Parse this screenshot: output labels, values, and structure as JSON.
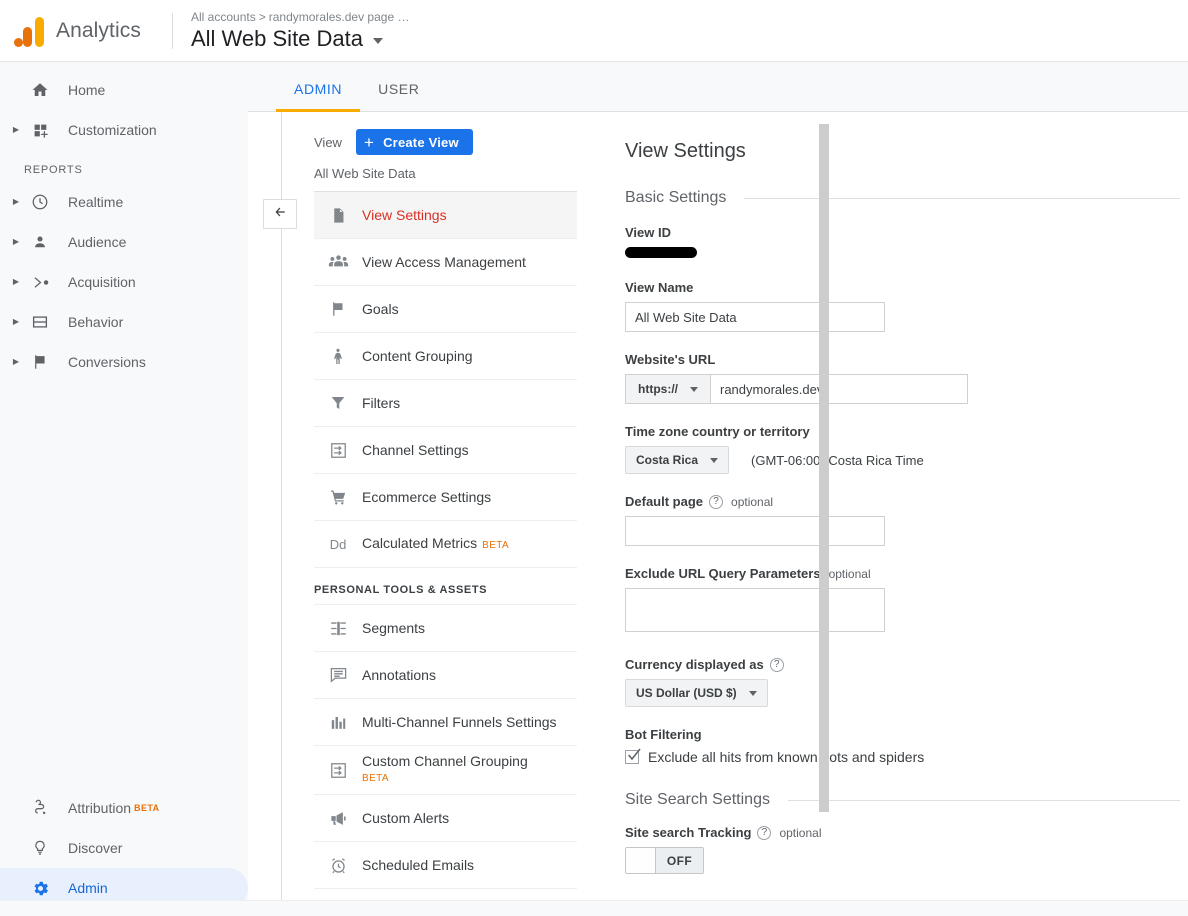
{
  "header": {
    "product": "Analytics",
    "breadcrumb": [
      "All accounts",
      "randymorales.dev page …"
    ],
    "breadcrumb_text": "All accounts",
    "breadcrumb_text2": "randymorales.dev page …",
    "view_title": "All Web Site Data"
  },
  "sidebar": {
    "items": [
      {
        "label": "Home",
        "icon": "home-icon",
        "expandable": false
      },
      {
        "label": "Customization",
        "icon": "customization-icon",
        "expandable": true
      }
    ],
    "reports_section": "REPORTS",
    "reports": [
      {
        "label": "Realtime",
        "icon": "clock-icon",
        "expandable": true
      },
      {
        "label": "Audience",
        "icon": "person-icon",
        "expandable": true
      },
      {
        "label": "Acquisition",
        "icon": "acquisition-icon",
        "expandable": true
      },
      {
        "label": "Behavior",
        "icon": "behavior-icon",
        "expandable": true
      },
      {
        "label": "Conversions",
        "icon": "flag-icon",
        "expandable": true
      }
    ],
    "bottom": [
      {
        "label": "Attribution",
        "icon": "attribution-icon",
        "badge": "BETA"
      },
      {
        "label": "Discover",
        "icon": "bulb-icon",
        "badge": ""
      },
      {
        "label": "Admin",
        "icon": "gear-icon",
        "badge": "",
        "active": true
      }
    ]
  },
  "tabs": [
    {
      "label": "ADMIN",
      "active": true
    },
    {
      "label": "USER",
      "active": false
    }
  ],
  "view_column": {
    "label": "View",
    "create_button": "Create View",
    "plus_glyph": "+",
    "current_view": "All Web Site Data",
    "items": [
      {
        "label": "View Settings",
        "icon": "page-icon",
        "selected": true,
        "badge": ""
      },
      {
        "label": "View Access Management",
        "icon": "people-icon",
        "badge": ""
      },
      {
        "label": "Goals",
        "icon": "flag-icon",
        "badge": ""
      },
      {
        "label": "Content Grouping",
        "icon": "content-grouping-icon",
        "badge": ""
      },
      {
        "label": "Filters",
        "icon": "funnel-icon",
        "badge": ""
      },
      {
        "label": "Channel Settings",
        "icon": "channel-icon",
        "badge": ""
      },
      {
        "label": "Ecommerce Settings",
        "icon": "cart-icon",
        "badge": ""
      },
      {
        "label": "Calculated Metrics",
        "icon": "dd-icon",
        "badge": "BETA"
      }
    ],
    "group_header": "PERSONAL TOOLS & ASSETS",
    "personal_items": [
      {
        "label": "Segments",
        "icon": "segments-icon",
        "badge": ""
      },
      {
        "label": "Annotations",
        "icon": "annotations-icon",
        "badge": ""
      },
      {
        "label": "Multi-Channel Funnels Settings",
        "icon": "bar-chart-icon",
        "badge": ""
      },
      {
        "label": "Custom Channel Grouping",
        "icon": "channel-icon",
        "badge": "BETA"
      },
      {
        "label": "Custom Alerts",
        "icon": "megaphone-icon",
        "badge": ""
      },
      {
        "label": "Scheduled Emails",
        "icon": "alarm-clock-icon",
        "badge": ""
      }
    ]
  },
  "main": {
    "title": "View Settings",
    "basic_settings_header": "Basic Settings",
    "view_id_label": "View ID",
    "view_id_value": "",
    "view_name_label": "View Name",
    "view_name_value": "All Web Site Data",
    "website_url_label": "Website's URL",
    "protocol_value": "https://",
    "website_url_value": "randymorales.dev",
    "timezone_label": "Time zone country or territory",
    "timezone_country": "Costa Rica",
    "timezone_note": "(GMT-06:00) Costa Rica Time",
    "default_page_label": "Default page",
    "default_page_optional": "optional",
    "default_page_value": "",
    "exclude_query_label": "Exclude URL Query Parameters",
    "exclude_query_optional": "optional",
    "exclude_query_value": "",
    "currency_label": "Currency displayed as",
    "currency_value": "US Dollar (USD $)",
    "bot_filtering_label": "Bot Filtering",
    "bot_filtering_checkbox_text": "Exclude all hits from known bots and spiders",
    "site_search_header": "Site Search Settings",
    "site_search_label": "Site search Tracking",
    "site_search_optional": "optional",
    "site_search_toggle": "OFF",
    "help_glyph": "?"
  },
  "colors": {
    "brand_blue": "#1a73e8",
    "brand_orange": "#f9ab00",
    "selected_red": "#d93025",
    "beta_orange": "#e8710a",
    "nav_active_bg": "#e8f0fe"
  }
}
